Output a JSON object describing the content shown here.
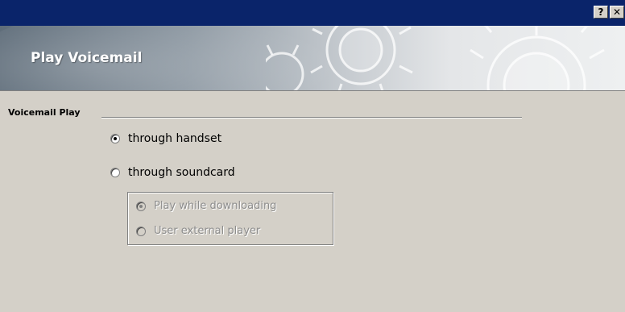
{
  "window": {
    "help_button": "?",
    "close_button": "✕"
  },
  "banner": {
    "title": "Play Voicemail"
  },
  "group": {
    "title": "Voicemail Play"
  },
  "options": {
    "handset": {
      "label": "through handset",
      "checked": true,
      "enabled": true
    },
    "soundcard": {
      "label": "through soundcard",
      "checked": false,
      "enabled": true
    },
    "download": {
      "label": "Play while downloading",
      "checked": true,
      "enabled": false
    },
    "external": {
      "label": "User external player",
      "checked": false,
      "enabled": false
    }
  },
  "colors": {
    "titlebar": "#0a246a",
    "dialog_bg": "#d4d0c8",
    "disabled_text": "#8d8d8d"
  }
}
